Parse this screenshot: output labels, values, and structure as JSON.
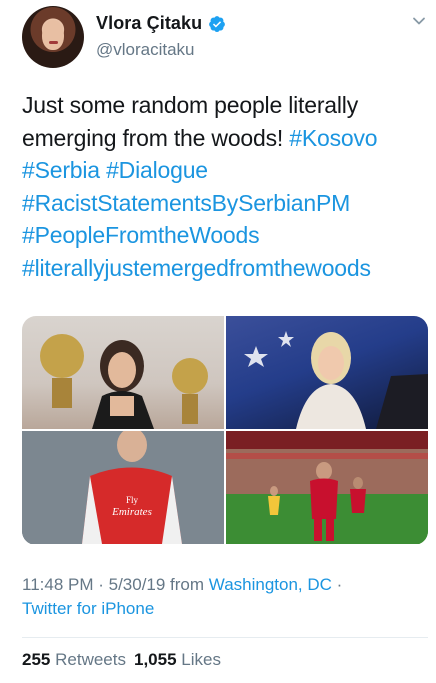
{
  "profile": {
    "name": "Vlora Çitaku",
    "handle": "@vloracitaku"
  },
  "tweet": {
    "line1": "Just some random people literally",
    "line2_text": "emerging from the woods! ",
    "line2_tag": "#Kosovo",
    "line3_tag1": "#Serbia",
    "line3_tag2": "#Dialogue",
    "line4_tag": "#RacistStatementsBySerbianPM",
    "line5_tag": "#PeopleFromtheWoods",
    "line6_tag": "#literallyjustemergedfromthewoods"
  },
  "media": {
    "photos": [
      {
        "label": ""
      },
      {
        "label": ""
      },
      {
        "label": "Fly Emirates"
      },
      {
        "label": ""
      }
    ]
  },
  "meta": {
    "time_date": "11:48 PM · 5/30/19 from ",
    "location": "Washington, DC",
    "separator": " ·",
    "client": "Twitter for iPhone"
  },
  "stats": {
    "retweets_count": "255",
    "retweets_label": "Retweets",
    "likes_count": "1,055",
    "likes_label": "Likes"
  },
  "colors": {
    "link": "#1b95e0",
    "secondary": "#657786",
    "verified": "#1da1f2"
  }
}
